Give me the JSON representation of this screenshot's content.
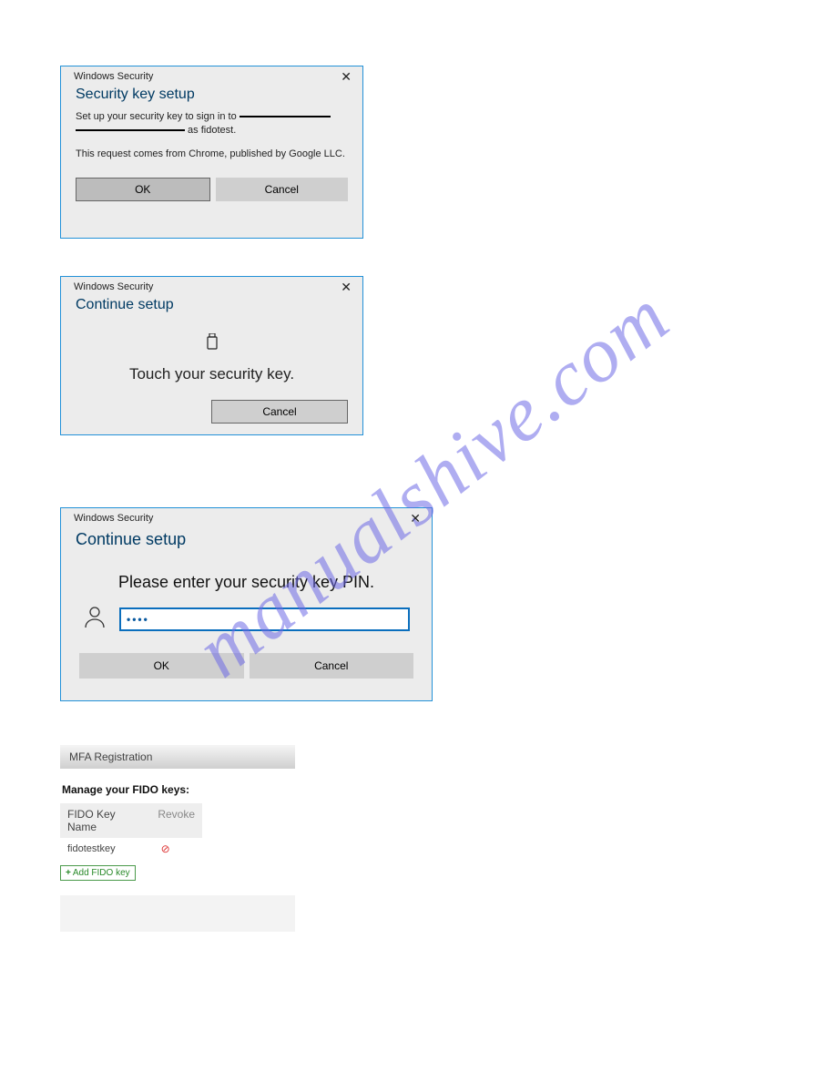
{
  "dialog1": {
    "titlebar": "Windows Security",
    "heading": "Security key setup",
    "line_pre": "Set up your security key to sign in to ",
    "line_tail": " as fidotest.",
    "subline": "This request comes from Chrome, published by Google LLC.",
    "ok": "OK",
    "cancel": "Cancel"
  },
  "dialog2": {
    "titlebar": "Windows Security",
    "heading": "Continue setup",
    "message": "Touch your security key.",
    "cancel": "Cancel"
  },
  "dialog3": {
    "titlebar": "Windows Security",
    "heading": "Continue setup",
    "message": "Please enter your security key PIN.",
    "pin_value": "••••",
    "ok": "OK",
    "cancel": "Cancel"
  },
  "mfa": {
    "header": "MFA Registration",
    "subtitle": "Manage your FIDO keys:",
    "col_name": "FIDO Key Name",
    "col_revoke": "Revoke",
    "rows": [
      {
        "name": "fidotestkey"
      }
    ],
    "add_label": "Add FIDO key"
  },
  "watermark": "manualshive.com"
}
